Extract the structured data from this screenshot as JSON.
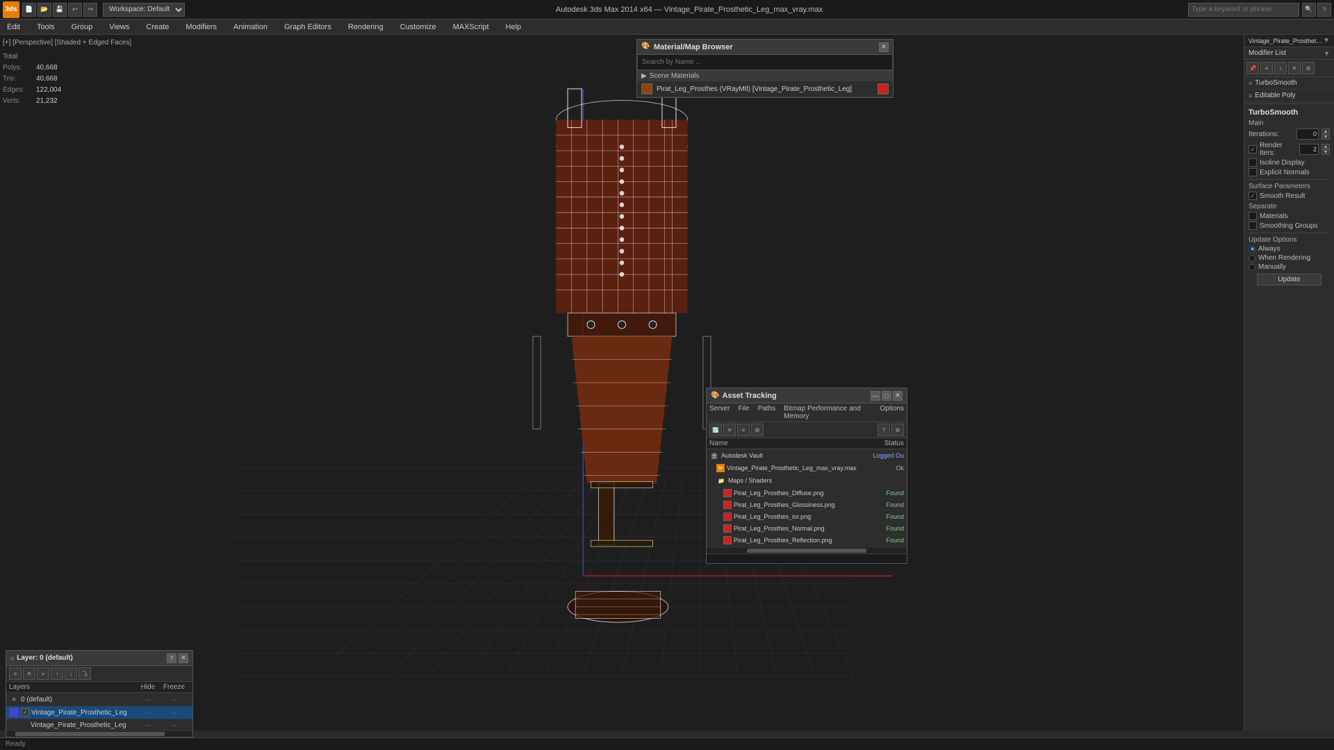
{
  "app": {
    "title": "Autodesk 3ds Max 2014 x64",
    "file": "Vintage_Pirate_Prosthetic_Leg_max_vray.max",
    "workspace": "Workspace: Default"
  },
  "menu": {
    "items": [
      "Edit",
      "Tools",
      "Group",
      "Views",
      "Create",
      "Modifiers",
      "Animation",
      "Graph Editors",
      "Rendering",
      "Customize",
      "MAXScript",
      "Help"
    ]
  },
  "viewport": {
    "label": "[+] [Perspective] [Shaded + Edged Faces]",
    "stats": {
      "polys_label": "Polys:",
      "polys_value": "40,668",
      "tris_label": "Tris:",
      "tris_value": "40,668",
      "edges_label": "Edges:",
      "edges_value": "122,004",
      "verts_label": "Verts:",
      "verts_value": "21,232",
      "total_label": "Total"
    }
  },
  "material_browser": {
    "title": "Material/Map Browser",
    "search_placeholder": "Search by Name ...",
    "section_label": "Scene Materials",
    "material_item": "Pirat_Leg_Prosthes (VRayMtl) [Vintage_Pirate_Prosthetic_Leg]"
  },
  "modifier_panel": {
    "title": "Modifier List",
    "object_name": "Vintage_Pirate_Prosthetic_Le",
    "items": [
      {
        "label": "TurboSmooth",
        "active": false
      },
      {
        "label": "Editable Poly",
        "active": false
      }
    ],
    "icons": [
      "▶",
      "■",
      "✕",
      "↑",
      "↓"
    ]
  },
  "turbosmooth": {
    "title": "TurboSmooth",
    "main_label": "Main",
    "iterations_label": "Iterations:",
    "iterations_value": "0",
    "render_iters_label": "Render Iters:",
    "render_iters_value": "2",
    "isoline_label": "Isoline Display",
    "explicit_normals_label": "Explicit Normals",
    "surface_params_label": "Surface Parameters",
    "smooth_result_label": "Smooth Result",
    "smooth_result_checked": true,
    "separate_label": "Separate",
    "materials_label": "Materials",
    "smoothing_groups_label": "Smoothing Groups",
    "update_options_label": "Update Options",
    "always_label": "Always",
    "when_rendering_label": "When Rendering",
    "manually_label": "Manually",
    "update_btn": "Update"
  },
  "asset_tracking": {
    "title": "Asset Tracking",
    "menus": [
      "Server",
      "File",
      "Paths",
      "Bitmap Performance and Memory",
      "Options"
    ],
    "columns": {
      "name": "Name",
      "status": "Status"
    },
    "rows": [
      {
        "indent": 0,
        "type": "vault",
        "name": "Autodesk Vault",
        "status": "Logged Ou",
        "icon": "🏛"
      },
      {
        "indent": 1,
        "type": "file",
        "name": "Vintage_Pirate_Prosthetic_Leg_max_vray.max",
        "status": "Ok"
      },
      {
        "indent": 1,
        "type": "folder",
        "name": "Maps / Shaders",
        "status": ""
      },
      {
        "indent": 2,
        "type": "image",
        "name": "Pirat_Leg_Prosthes_Diffuse.png",
        "status": "Found"
      },
      {
        "indent": 2,
        "type": "image",
        "name": "Pirat_Leg_Prosthes_Glossiness.png",
        "status": "Found"
      },
      {
        "indent": 2,
        "type": "image",
        "name": "Pirat_Leg_Prosthes_ior.png",
        "status": "Found"
      },
      {
        "indent": 2,
        "type": "image",
        "name": "Pirat_Leg_Prosthes_Normal.png",
        "status": "Found"
      },
      {
        "indent": 2,
        "type": "image",
        "name": "Pirat_Leg_Prosthes_Reflection.png",
        "status": "Found"
      }
    ]
  },
  "layers": {
    "title": "Layer: 0 (default)",
    "columns": {
      "name": "Layers",
      "hide": "Hide",
      "freeze": "Freeze"
    },
    "rows": [
      {
        "indent": 0,
        "name": "0 (default)",
        "hide": "—",
        "freeze": "—",
        "active": false
      },
      {
        "indent": 1,
        "name": "Vintage_Pirate_Prosthetic_Leg",
        "hide": "—",
        "freeze": "—",
        "active": true
      },
      {
        "indent": 2,
        "name": "Vintage_Pirate_Prosthetic_Leg",
        "hide": "—",
        "freeze": "—",
        "active": false
      }
    ]
  },
  "colors": {
    "accent_blue": "#1a4a7a",
    "accent_orange": "#e67e00",
    "status_ok": "#88cc88",
    "status_found": "#88cc88",
    "status_logged": "#88aaff",
    "material_swatch": "#8b4513",
    "material_swatch_red": "#cc2222"
  }
}
